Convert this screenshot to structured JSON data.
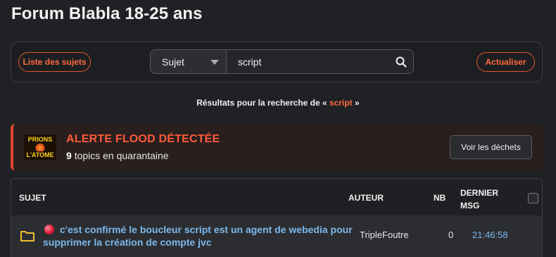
{
  "page": {
    "title": "Forum Blabla 18-25 ans"
  },
  "toolbar": {
    "topics_button": "Liste des sujets",
    "refresh_button": "Actualiser",
    "search_scope": "Sujet",
    "search_value": "script",
    "search_icon": "search-icon"
  },
  "results": {
    "prefix": "Résultats pour la recherche de «",
    "term": "script",
    "suffix": "»"
  },
  "alert": {
    "logo_line1": "PRIONS",
    "logo_line2": "L'ATOME",
    "title": "ALERTE FLOOD DÉTECTÉE",
    "count": "9",
    "count_text": "topics en quarantaine",
    "button": "Voir les déchets",
    "accent_color": "#e0452b"
  },
  "table": {
    "headers": {
      "subject": "SUJET",
      "author": "AUTEUR",
      "nb": "NB",
      "last_line1": "DERNIER",
      "last_line2": "MSG"
    },
    "rows": [
      {
        "icon": "folder-icon",
        "status": "red-dot-icon",
        "title": "c'est confirmé le boucleur script est un agent de webedia pour supprimer la création de compte jvc",
        "author": "TripleFoutre",
        "nb": "0",
        "last": "21:46:58"
      }
    ]
  },
  "colors": {
    "background": "#202124",
    "accent": "#ff6a3d",
    "link": "#7db8ea",
    "folder": "#f2c12e"
  }
}
